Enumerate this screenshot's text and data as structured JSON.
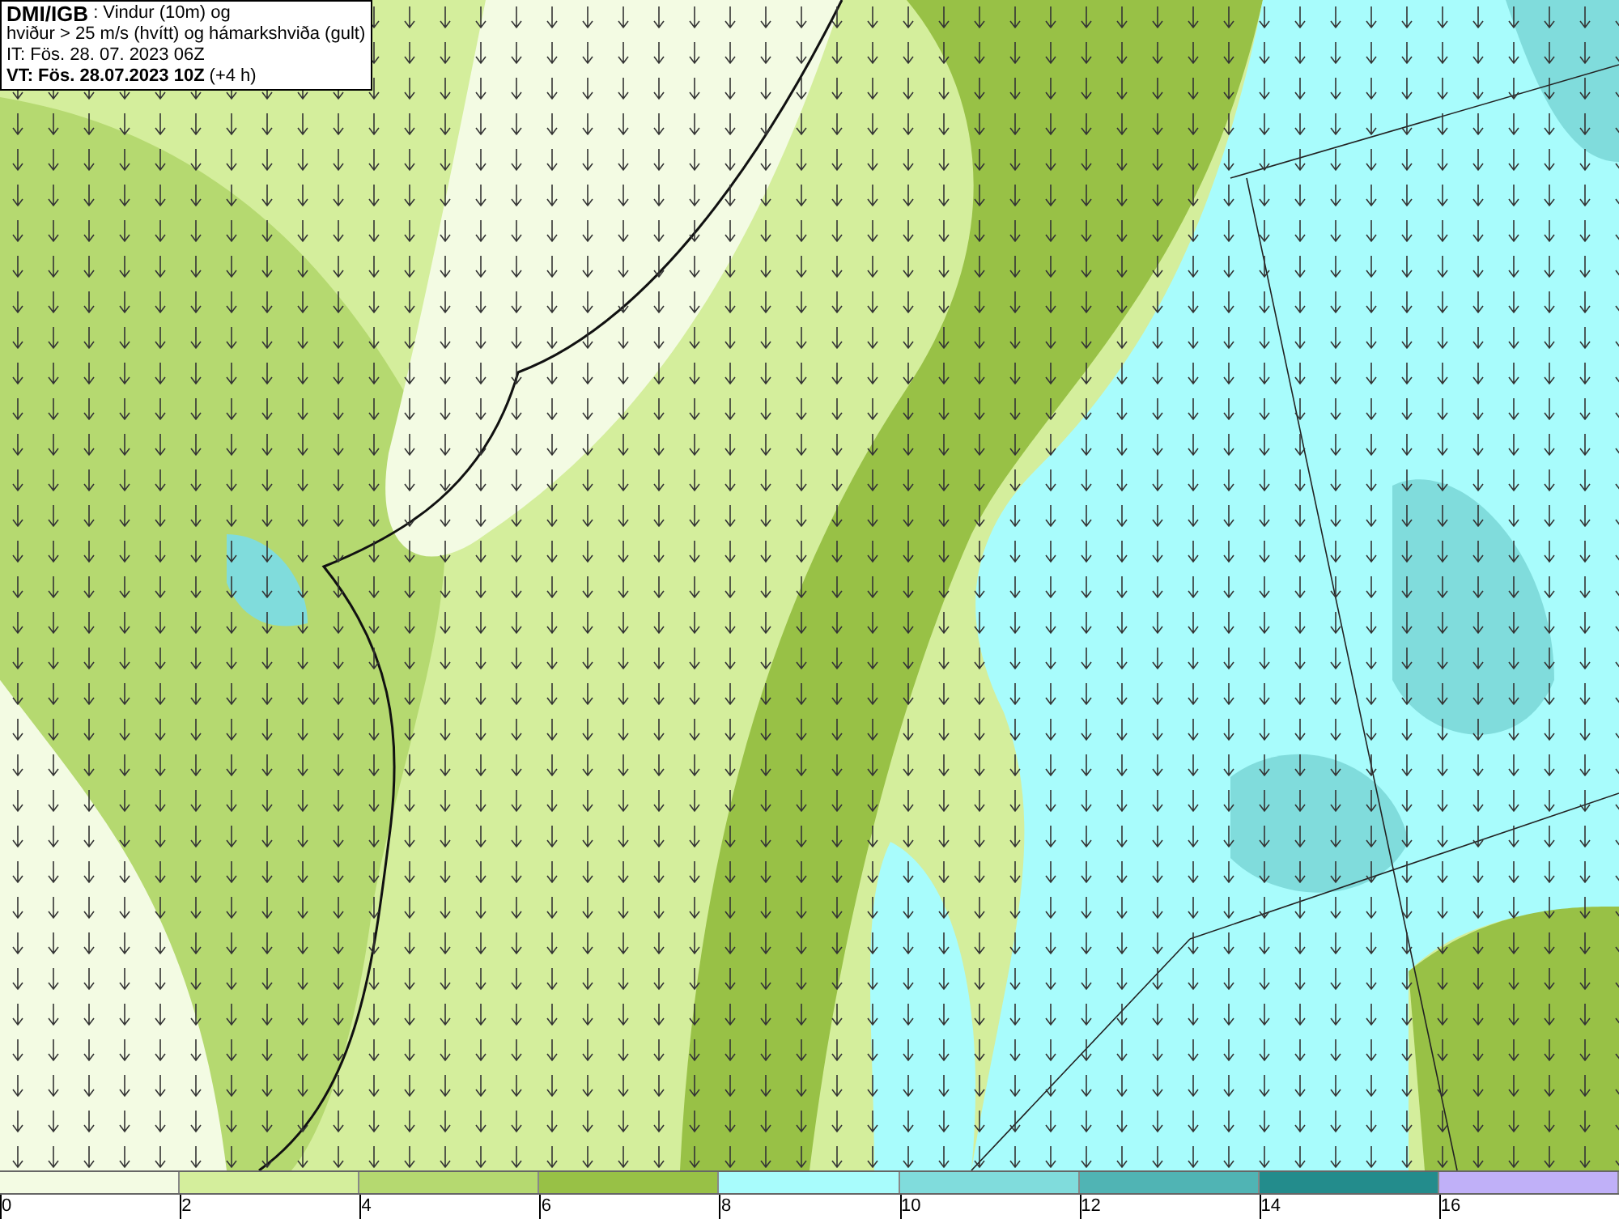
{
  "header": {
    "source": "DMI/IGB",
    "title_line_1": ": Vindur (10m) og",
    "title_line_2": "hviður > 25 m/s (hvítt) og hámarkshviða (gult)",
    "issue_time": "IT: Fös. 28. 07. 2023 06Z",
    "valid_time": "VT: Fös. 28.07.2023 10Z",
    "lead_time": "(+4 h)"
  },
  "legend": {
    "bins": [
      {
        "color": "#f3fbe3"
      },
      {
        "color": "#d4ee9c"
      },
      {
        "color": "#b5d970"
      },
      {
        "color": "#98c146"
      },
      {
        "color": "#a8fcfc"
      },
      {
        "color": "#80dcdc"
      },
      {
        "color": "#50b4b4"
      },
      {
        "color": "#238c8c"
      },
      {
        "color": "#c0b0f8"
      }
    ],
    "ticks": [
      "0",
      "2",
      "4",
      "6",
      "8",
      "10",
      "12",
      "14",
      "16"
    ]
  }
}
